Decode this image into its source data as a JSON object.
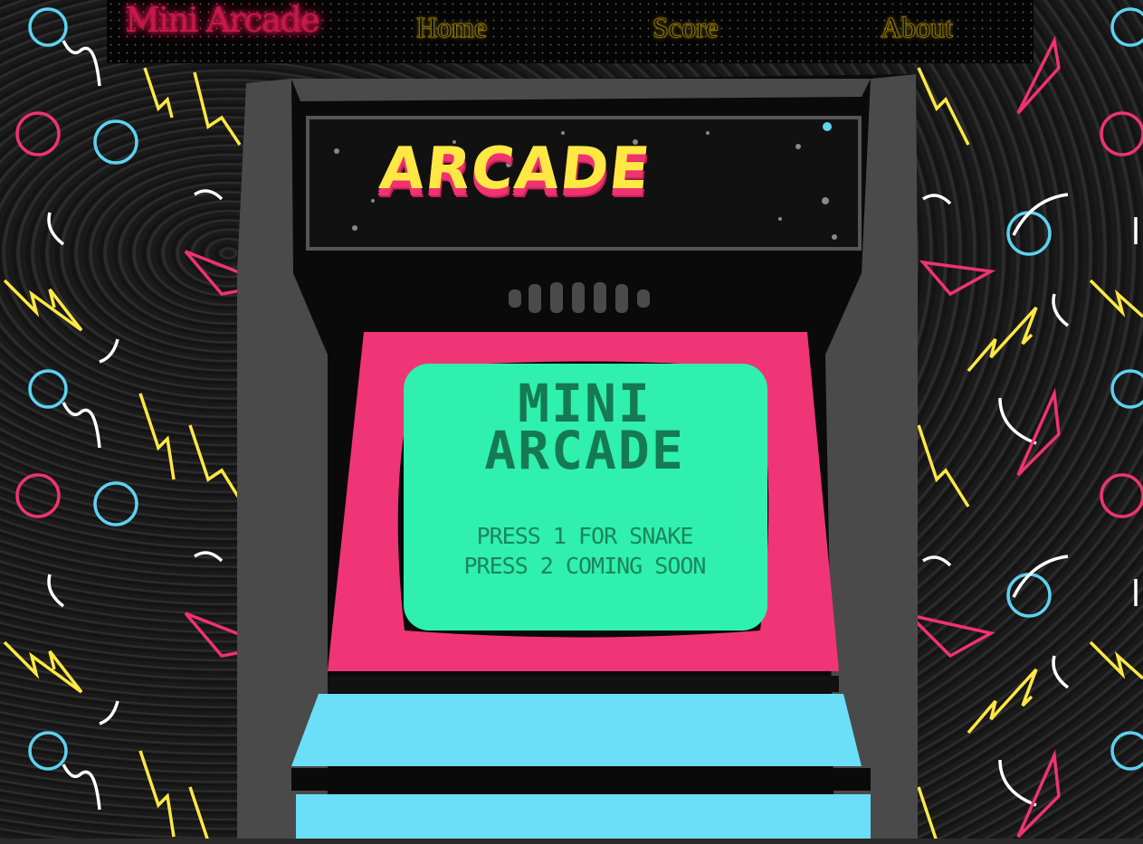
{
  "nav": {
    "brand": "Mini Arcade",
    "links": [
      {
        "label": "Home"
      },
      {
        "label": "Score"
      },
      {
        "label": "About"
      }
    ]
  },
  "cabinet": {
    "marquee": "ARCADE",
    "screen_title": "MINI ARCADE",
    "screen_lines": [
      "PRESS 1 FOR SNAKE",
      "PRESS 2 COMING SOON"
    ]
  },
  "colors": {
    "brand_neon": "#ff2a64",
    "nav_gold": "#c9a400",
    "cabinet_gray": "#4a4a4a",
    "bezel_pink": "#f03576",
    "screen_green": "#2ff0ae",
    "panel_blue": "#6adff7",
    "marquee_yellow": "#ffe843"
  }
}
